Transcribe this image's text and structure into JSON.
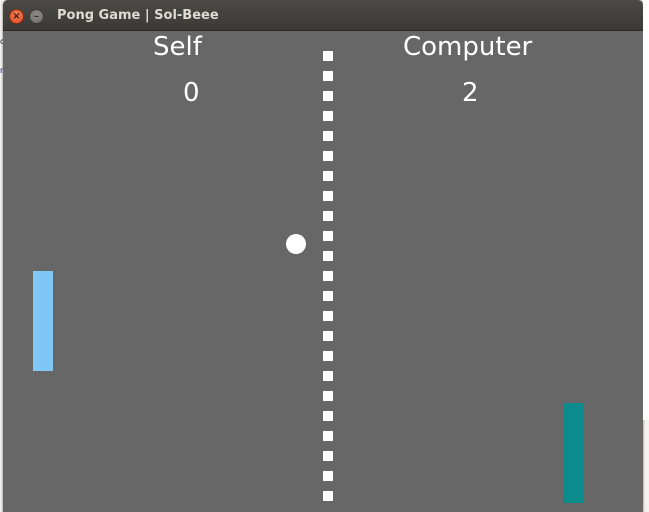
{
  "window": {
    "title": "Pong Game | Sol-Beee",
    "close_glyph": "×",
    "minimize_glyph": "–"
  },
  "scoreboard": {
    "left_player": "Self",
    "right_player": "Computer",
    "left_score": "0",
    "right_score": "2"
  },
  "colors": {
    "field": "#676767",
    "net": "#ffffff",
    "ball": "#ffffff",
    "left_paddle": "#7fc7f7",
    "right_paddle": "#0b8b8b"
  },
  "icons": {
    "close": "close-icon",
    "minimize": "minimize-icon"
  }
}
